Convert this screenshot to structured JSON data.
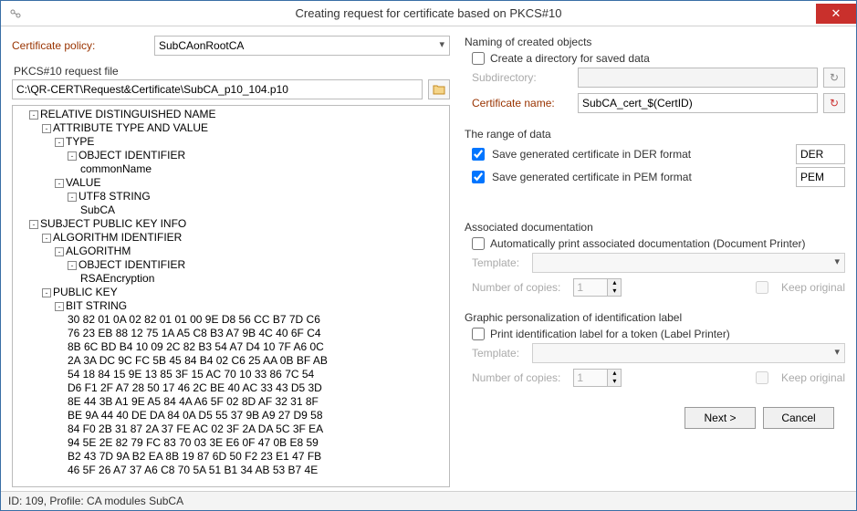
{
  "window": {
    "title": "Creating request for certificate based on PKCS#10",
    "close_tooltip": "Close"
  },
  "left": {
    "policy_label": "Certificate policy:",
    "policy_value": "SubCAonRootCA",
    "pkcs_label": "PKCS#10 request file",
    "pkcs_path": "C:\\QR-CERT\\Request&Certificate\\SubCA_p10_104.p10",
    "tree": [
      {
        "t": "⊟",
        "d": 1,
        "l": "RELATIVE DISTINGUISHED NAME"
      },
      {
        "t": "⊟",
        "d": 2,
        "l": "ATTRIBUTE TYPE AND VALUE"
      },
      {
        "t": "⊟",
        "d": 3,
        "l": "TYPE"
      },
      {
        "t": "⊟",
        "d": 4,
        "l": "OBJECT IDENTIFIER"
      },
      {
        "t": "",
        "d": 5,
        "l": "commonName"
      },
      {
        "t": "⊟",
        "d": 3,
        "l": "VALUE"
      },
      {
        "t": "⊟",
        "d": 4,
        "l": "UTF8 STRING"
      },
      {
        "t": "",
        "d": 5,
        "l": "SubCA"
      },
      {
        "t": "⊟",
        "d": 1,
        "l": "SUBJECT PUBLIC KEY INFO"
      },
      {
        "t": "⊟",
        "d": 2,
        "l": "ALGORITHM IDENTIFIER"
      },
      {
        "t": "⊟",
        "d": 3,
        "l": "ALGORITHM"
      },
      {
        "t": "⊟",
        "d": 4,
        "l": "OBJECT IDENTIFIER"
      },
      {
        "t": "",
        "d": 5,
        "l": "RSAEncryption"
      },
      {
        "t": "⊟",
        "d": 2,
        "l": "PUBLIC KEY"
      },
      {
        "t": "⊟",
        "d": 3,
        "l": "BIT STRING"
      },
      {
        "t": "",
        "d": 4,
        "l": "30 82 01 0A 02 82 01 01 00 9E D8 56 CC B7 7D C6"
      },
      {
        "t": "",
        "d": 4,
        "l": "76 23 EB 88 12 75 1A A5 C8 B3 A7 9B 4C 40 6F C4"
      },
      {
        "t": "",
        "d": 4,
        "l": "8B 6C BD B4 10 09 2C 82 B3 54 A7 D4 10 7F A6 0C"
      },
      {
        "t": "",
        "d": 4,
        "l": "2A 3A DC 9C FC 5B 45 84 B4 02 C6 25 AA 0B BF AB"
      },
      {
        "t": "",
        "d": 4,
        "l": "54 18 84 15 9E 13 85 3F 15 AC 70 10 33 86 7C 54"
      },
      {
        "t": "",
        "d": 4,
        "l": "D6 F1 2F A7 28 50 17 46 2C BE 40 AC 33 43 D5 3D"
      },
      {
        "t": "",
        "d": 4,
        "l": "8E 44 3B A1 9E A5 84 4A A6 5F 02 8D AF 32 31 8F"
      },
      {
        "t": "",
        "d": 4,
        "l": "BE 9A 44 40 DE DA 84 0A D5 55 37 9B A9 27 D9 58"
      },
      {
        "t": "",
        "d": 4,
        "l": "84 F0 2B 31 87 2A 37 FE AC 02 3F 2A DA 5C 3F EA"
      },
      {
        "t": "",
        "d": 4,
        "l": "94 5E 2E 82 79 FC 83 70 03 3E E6 0F 47 0B E8 59"
      },
      {
        "t": "",
        "d": 4,
        "l": "B2 43 7D 9A B2 EA 8B 19 87 6D 50 F2 23 E1 47 FB"
      },
      {
        "t": "",
        "d": 4,
        "l": "46 5F 26 A7 37 A6 C8 70 5A 51 B1 34 AB 53 B7 4E"
      }
    ]
  },
  "right": {
    "naming": {
      "title": "Naming of created objects",
      "create_dir": "Create a directory for saved data",
      "subdir_label": "Subdirectory:",
      "subdir_value": "",
      "certname_label": "Certificate name:",
      "certname_value": "SubCA_cert_$(CertID)"
    },
    "range": {
      "title": "The range of data",
      "der_label": "Save generated certificate in DER format",
      "der_suffix": "DER",
      "pem_label": "Save generated certificate in PEM format",
      "pem_suffix": "PEM"
    },
    "docs": {
      "title": "Associated documentation",
      "auto_print": "Automatically print associated documentation (Document Printer)",
      "template_label": "Template:",
      "copies_label": "Number of copies:",
      "copies_value": "1",
      "keep_original": "Keep original"
    },
    "graphic": {
      "title": "Graphic personalization of identification label",
      "print_label": "Print identification label for a token (Label Printer)",
      "template_label": "Template:",
      "copies_label": "Number of copies:",
      "copies_value": "1",
      "keep_original": "Keep original"
    }
  },
  "footer": {
    "next": "Next >",
    "cancel": "Cancel"
  },
  "status": "ID: 109, Profile: CA modules SubCA"
}
